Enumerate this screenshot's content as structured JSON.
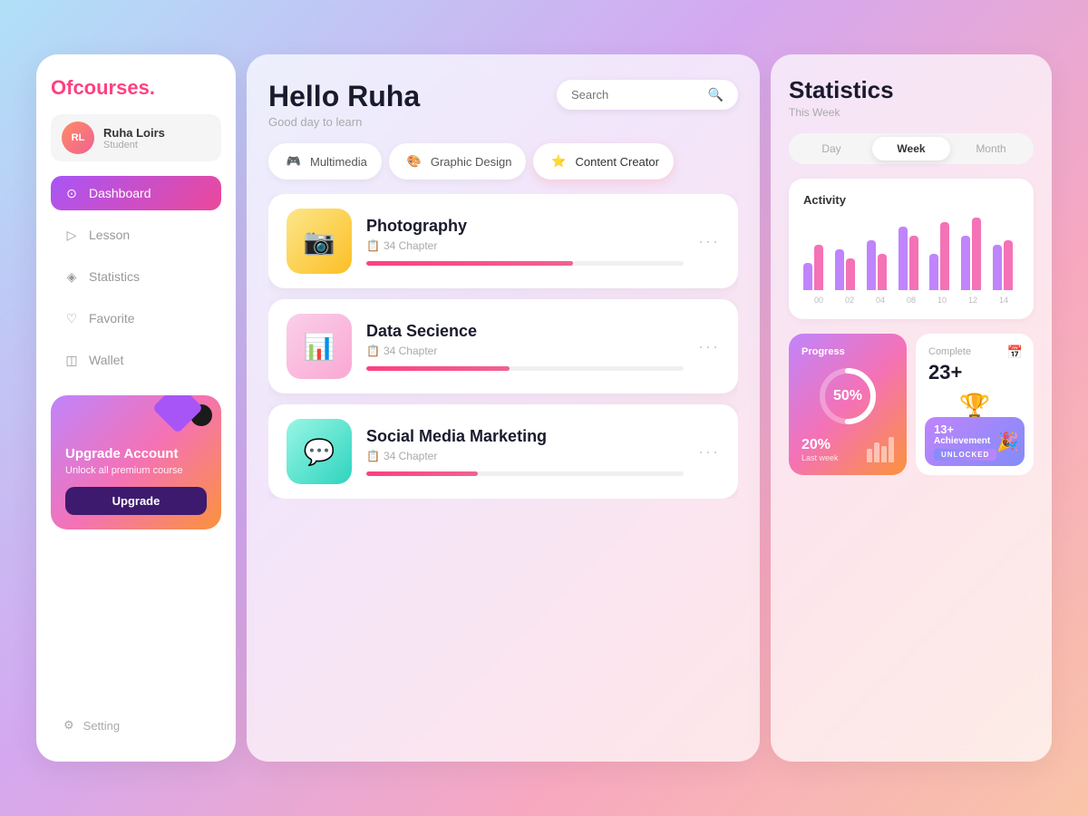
{
  "sidebar": {
    "logo": "Ofcourses",
    "logo_dot": ".",
    "user": {
      "name": "Ruha Loirs",
      "role": "Student",
      "initials": "RL"
    },
    "nav": [
      {
        "id": "dashboard",
        "label": "Dashboard",
        "icon": "⊙",
        "active": true
      },
      {
        "id": "lesson",
        "label": "Lesson",
        "icon": "▷"
      },
      {
        "id": "statistics",
        "label": "Statistics",
        "icon": "◈"
      },
      {
        "id": "favorite",
        "label": "Favorite",
        "icon": "♡"
      },
      {
        "id": "wallet",
        "label": "Wallet",
        "icon": "◫"
      }
    ],
    "upgrade": {
      "title": "Upgrade Account",
      "description": "Unlock all premium course",
      "button": "Upgrade"
    },
    "setting": {
      "label": "Setting",
      "icon": "⚙"
    }
  },
  "center": {
    "greeting": "Hello Ruha",
    "subtitle": "Good day to learn",
    "search_placeholder": "Search",
    "categories": [
      {
        "id": "multimedia",
        "label": "Multimedia",
        "icon": "🎮",
        "active": false
      },
      {
        "id": "graphic",
        "label": "Graphic Design",
        "icon": "🎨",
        "active": false
      },
      {
        "id": "creator",
        "label": "Content Creator",
        "icon": "⭐",
        "active": true
      }
    ],
    "courses": [
      {
        "id": "photography",
        "title": "Photography",
        "chapters": "34 Chapter",
        "progress": 65,
        "icon": "📷",
        "color": "yellow"
      },
      {
        "id": "data-science",
        "title": "Data Secience",
        "chapters": "34 Chapter",
        "progress": 45,
        "icon": "📊",
        "color": "pink"
      },
      {
        "id": "social-media",
        "title": "Social Media Marketing",
        "chapters": "34 Chapter",
        "progress": 35,
        "icon": "💬",
        "color": "teal"
      }
    ]
  },
  "stats": {
    "title": "Statistics",
    "subtitle": "This Week",
    "time_tabs": [
      "Day",
      "Week",
      "Month"
    ],
    "active_tab": "Week",
    "activity_label": "Activity",
    "chart_labels": [
      "00",
      "02",
      "04",
      "08",
      "10",
      "12",
      "14"
    ],
    "chart_data": [
      {
        "purple": 30,
        "pink": 50
      },
      {
        "purple": 45,
        "pink": 35
      },
      {
        "purple": 55,
        "pink": 40
      },
      {
        "purple": 70,
        "pink": 60
      },
      {
        "purple": 40,
        "pink": 75
      },
      {
        "purple": 60,
        "pink": 80
      },
      {
        "purple": 50,
        "pink": 55
      }
    ],
    "progress": {
      "label": "Progress",
      "value": 50,
      "display": "50%",
      "last_week_label": "Last week",
      "last_week_value": "20%"
    },
    "complete": {
      "label": "Complete",
      "value": "23+",
      "achievement_label": "Achievement",
      "achievement_value": "13+",
      "unlocked": "UNLOCKED"
    }
  }
}
